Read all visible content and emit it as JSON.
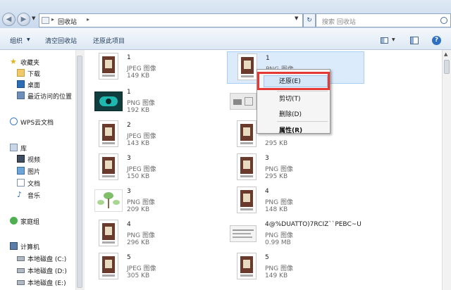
{
  "address": {
    "path_segment": "回收站",
    "search_placeholder": "搜索 回收站"
  },
  "toolbar": {
    "organize": "组织",
    "empty_recycle_bin": "清空回收站",
    "restore_all": "还原此项目"
  },
  "sidebar": {
    "items": [
      {
        "label": "收藏夹",
        "icon": "star-icon"
      },
      {
        "label": "下载",
        "icon": "download-folder-icon"
      },
      {
        "label": "桌面",
        "icon": "desktop-icon"
      },
      {
        "label": "最近访问的位置",
        "icon": "recent-places-icon"
      },
      {
        "label": "WPS云文档",
        "icon": "cloud-icon"
      },
      {
        "label": "库",
        "icon": "library-icon"
      },
      {
        "label": "视频",
        "icon": "video-library-icon"
      },
      {
        "label": "图片",
        "icon": "pictures-library-icon"
      },
      {
        "label": "文档",
        "icon": "documents-library-icon"
      },
      {
        "label": "音乐",
        "icon": "music-library-icon"
      },
      {
        "label": "家庭组",
        "icon": "homegroup-icon"
      },
      {
        "label": "计算机",
        "icon": "computer-icon"
      },
      {
        "label": "本地磁盘 (C:)",
        "icon": "drive-icon"
      },
      {
        "label": "本地磁盘 (D:)",
        "icon": "drive-icon"
      },
      {
        "label": "本地磁盘 (E:)",
        "icon": "drive-icon"
      }
    ]
  },
  "files": [
    {
      "name": "1",
      "type": "JPEG 图像",
      "size": "149 KB",
      "thumb": "jpeg-portrait-thumbnail"
    },
    {
      "name": "1",
      "type": "PNG 图像",
      "size": "",
      "thumb": "png-portrait-thumbnail",
      "selected": true
    },
    {
      "name": "1",
      "type": "PNG 图像",
      "size": "192 KB",
      "thumb": "teal-graphic-thumbnail"
    },
    {
      "name": "",
      "type": "",
      "size": "",
      "thumb": "sketch-thumbnail"
    },
    {
      "name": "2",
      "type": "JPEG 图像",
      "size": "143 KB",
      "thumb": "jpeg-portrait-thumbnail"
    },
    {
      "name": "",
      "type": "",
      "size": "295 KB",
      "thumb": "png-portrait-thumbnail"
    },
    {
      "name": "3",
      "type": "JPEG 图像",
      "size": "150 KB",
      "thumb": "jpeg-portrait-thumbnail"
    },
    {
      "name": "3",
      "type": "PNG 图像",
      "size": "295 KB",
      "thumb": "png-portrait-thumbnail"
    },
    {
      "name": "3",
      "type": "PNG 图像",
      "size": "209 KB",
      "thumb": "tree-diagram-thumbnail"
    },
    {
      "name": "4",
      "type": "PNG 图像",
      "size": "148 KB",
      "thumb": "png-portrait-thumbnail"
    },
    {
      "name": "4",
      "type": "PNG 图像",
      "size": "296 KB",
      "thumb": "png-portrait-thumbnail"
    },
    {
      "name": "4@%DUATTO)7RCIZ``PEBC~U",
      "type": "PNG 图像",
      "size": "0.99 MB",
      "thumb": "text-screenshot-thumbnail"
    },
    {
      "name": "5",
      "type": "JPEG 图像",
      "size": "305 KB",
      "thumb": "jpeg-portrait-thumbnail"
    },
    {
      "name": "5",
      "type": "PNG 图像",
      "size": "149 KB",
      "thumb": "png-portrait-thumbnail"
    }
  ],
  "context_menu": {
    "restore": "还原(E)",
    "cut": "剪切(T)",
    "delete": "删除(D)",
    "properties": "属性(R)"
  },
  "colors": {
    "highlight_border": "#e53935",
    "selection_bg": "#dcebfc",
    "link_text": "#1e395b"
  }
}
